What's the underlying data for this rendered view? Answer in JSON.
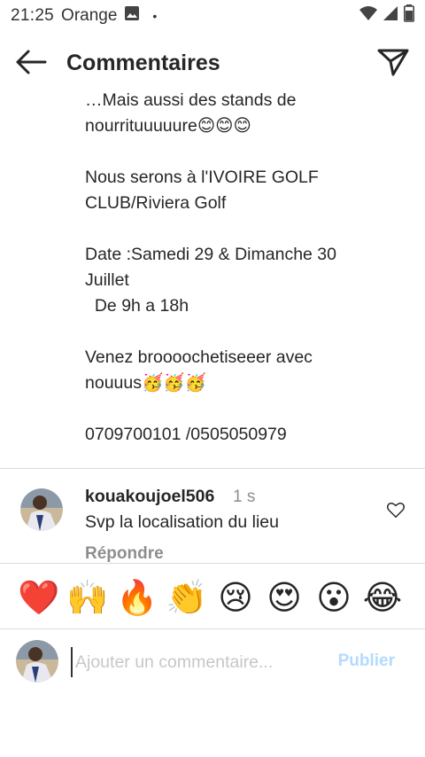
{
  "status_bar": {
    "time": "21:25",
    "carrier": "Orange",
    "dot": "•",
    "icons": [
      "gallery-icon",
      "wifi-icon",
      "signal-icon",
      "battery-icon"
    ]
  },
  "header": {
    "title": "Commentaires",
    "back_icon": "arrow-left-icon",
    "send_icon": "paper-plane-icon"
  },
  "caption": {
    "text": "…Mais aussi des stands de\nnourrituuuuure😊😊😊\n\nNous serons à l'IVOIRE GOLF\nCLUB/Riviera Golf\n\nDate :Samedi 29 & Dimanche 30\nJuillet\n  De 9h a 18h\n\nVenez broooochetiseeer avec\nnouuus🥳🥳🥳\n\n0709700101 /0505050979"
  },
  "comment": {
    "username": "kouakoujoel506",
    "time": "1 s",
    "text": "Svp la localisation du lieu",
    "reply_label": "Répondre",
    "like_icon": "heart-outline-icon"
  },
  "emoji_bar": {
    "emojis": [
      "❤️",
      "🙌",
      "🔥",
      "👏",
      "😢",
      "😍",
      "😮",
      "😂"
    ]
  },
  "input": {
    "placeholder": "Ajouter un commentaire...",
    "value": "",
    "publish_label": "Publier"
  },
  "colors": {
    "text": "#262626",
    "secondary": "#8e8e8e",
    "divider": "#dbdbdb",
    "publish_disabled": "#b3dbff"
  }
}
